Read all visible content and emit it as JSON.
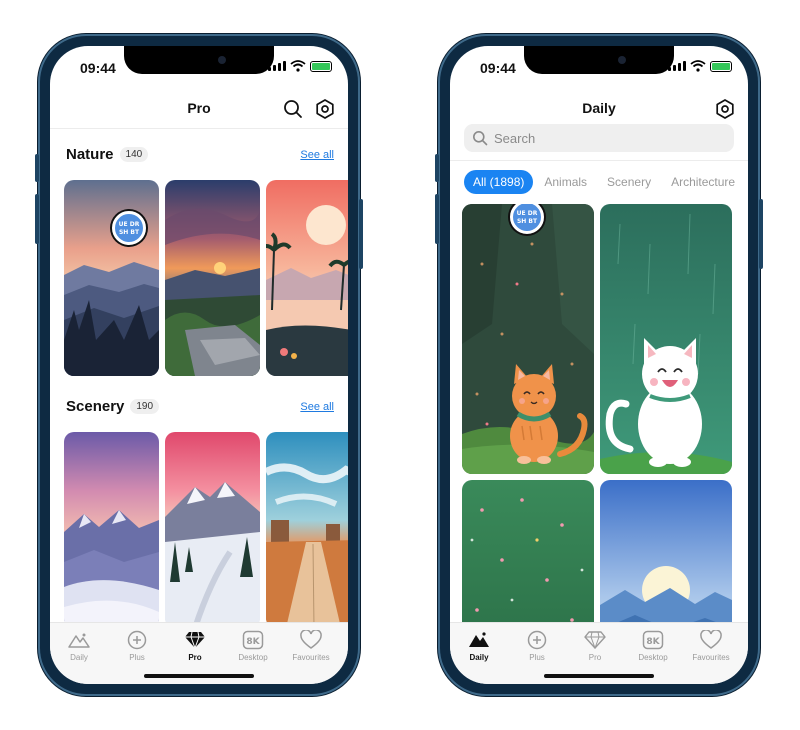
{
  "colors": {
    "accent": "#1a84f2",
    "link": "#1f7ae0",
    "frame": "#0e2a42"
  },
  "left_phone": {
    "status": {
      "time": "09:44"
    },
    "header": {
      "title": "Pro",
      "search_icon": "search-icon",
      "settings_icon": "settings-icon"
    },
    "sections": [
      {
        "name": "Nature",
        "count": "140",
        "see_all": "See all"
      },
      {
        "name": "Scenery",
        "count": "190",
        "see_all": "See all"
      }
    ],
    "badge": {
      "line1": "UE DR",
      "line2": "SH BT"
    },
    "tabs": [
      {
        "label": "Daily",
        "icon": "mountain-icon"
      },
      {
        "label": "Plus",
        "icon": "plus-circle-icon"
      },
      {
        "label": "Pro",
        "icon": "diamond-icon",
        "active": true
      },
      {
        "label": "Desktop",
        "icon": "8k-icon"
      },
      {
        "label": "Favourites",
        "icon": "heart-icon"
      }
    ]
  },
  "right_phone": {
    "status": {
      "time": "09:44"
    },
    "header": {
      "title": "Daily",
      "settings_icon": "settings-icon"
    },
    "search": {
      "placeholder": "Search"
    },
    "chips": [
      {
        "label": "All (1898)",
        "active": true
      },
      {
        "label": "Animals"
      },
      {
        "label": "Scenery"
      },
      {
        "label": "Architecture"
      }
    ],
    "badge": {
      "line1": "UE DR",
      "line2": "SH BT"
    },
    "tabs": [
      {
        "label": "Daily",
        "icon": "mountain-icon",
        "active": true
      },
      {
        "label": "Plus",
        "icon": "plus-circle-icon"
      },
      {
        "label": "Pro",
        "icon": "diamond-icon"
      },
      {
        "label": "Desktop",
        "icon": "8k-icon"
      },
      {
        "label": "Favourites",
        "icon": "heart-icon"
      }
    ]
  }
}
